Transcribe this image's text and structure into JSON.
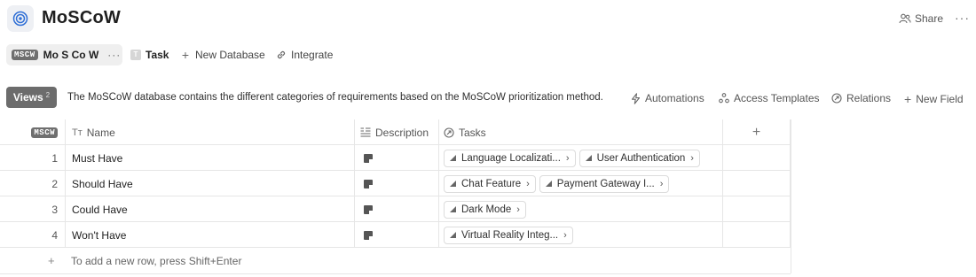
{
  "header": {
    "title": "MoSCoW",
    "share_label": "Share",
    "more_label": "···"
  },
  "tabs": {
    "active": {
      "tag": "MSCW",
      "label": "Mo S Co W",
      "more": "···"
    },
    "items": [
      {
        "label": "Task",
        "icon": "task-icon"
      },
      {
        "label": "New Database",
        "icon": "plus-icon"
      },
      {
        "label": "Integrate",
        "icon": "link-icon"
      }
    ]
  },
  "toolbar": {
    "views_label": "Views",
    "views_count": "2",
    "description": "The MoSCoW database contains the different categories of requirements based on the MoSCoW prioritization method.",
    "actions": [
      {
        "label": "Automations",
        "icon": "lightning-icon"
      },
      {
        "label": "Access Templates",
        "icon": "templates-icon"
      },
      {
        "label": "Relations",
        "icon": "relations-icon"
      },
      {
        "label": "New Field",
        "icon": "plus-icon"
      }
    ]
  },
  "table": {
    "columns": {
      "index_tag": "MSCW",
      "name": "Name",
      "description": "Description",
      "tasks": "Tasks",
      "add": "+"
    },
    "rows": [
      {
        "index": "1",
        "name": "Must Have",
        "tasks": [
          "Language Localizati...",
          "User Authentication"
        ]
      },
      {
        "index": "2",
        "name": "Should Have",
        "tasks": [
          "Chat Feature",
          "Payment Gateway I..."
        ]
      },
      {
        "index": "3",
        "name": "Could Have",
        "tasks": [
          "Dark Mode"
        ]
      },
      {
        "index": "4",
        "name": "Won't Have",
        "tasks": [
          "Virtual Reality Integ..."
        ]
      }
    ],
    "add_row_text": "To add a new row, press Shift+Enter",
    "add_row_plus": "+"
  },
  "colors": {
    "views_bg": "#6c6c6c",
    "tag_bg": "#6f6f6f",
    "border": "#e6e6e6",
    "accent_icon": "#2f6fd6"
  }
}
